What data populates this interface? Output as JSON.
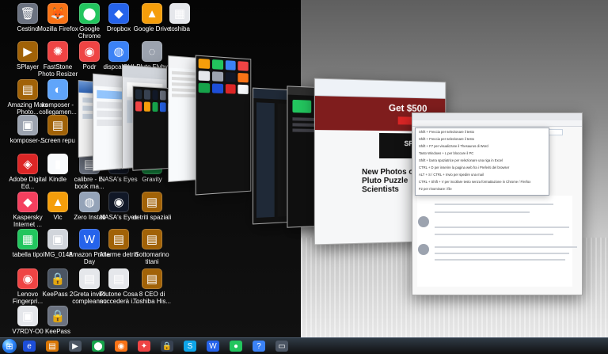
{
  "desktop": {
    "icons": [
      {
        "label": "Cestino",
        "glyph": "🗑",
        "color": "#6b7280"
      },
      {
        "label": "Mozilla Firefox",
        "glyph": "🦊",
        "color": "#f97316"
      },
      {
        "label": "Google Chrome",
        "glyph": "⬤",
        "color": "#22c55e"
      },
      {
        "label": "Dropbox",
        "glyph": "◆",
        "color": "#2563eb"
      },
      {
        "label": "Google Drive",
        "glyph": "▲",
        "color": "#f59e0b"
      },
      {
        "label": "toshiba",
        "glyph": "▦",
        "color": "#e5e7eb"
      },
      {
        "label": "SPlayer",
        "glyph": "▶",
        "color": "#a16207"
      },
      {
        "label": "FastStone Photo Resizer",
        "glyph": "✺",
        "color": "#ef4444"
      },
      {
        "label": "Podr",
        "glyph": "◉",
        "color": "#ef4444"
      },
      {
        "label": "dispcalGUI",
        "glyph": "◍",
        "color": "#3b82f6"
      },
      {
        "label": "Pluto Flyby",
        "glyph": "◌",
        "color": "#9ca3af"
      },
      {
        "label": "Amazing Mars Photo...",
        "glyph": "▤",
        "color": "#a16207"
      },
      {
        "label": "komposer - collegamen...",
        "glyph": "◐",
        "color": "#60a5fa"
      },
      {
        "label": "komposer-...",
        "glyph": "▣",
        "color": "#9ca3af"
      },
      {
        "label": "Screen repu",
        "glyph": "▤",
        "color": "#a16207"
      },
      {
        "label": "Adobe Digital Ed...",
        "glyph": "◈",
        "color": "#dc2626"
      },
      {
        "label": "Kindle",
        "glyph": "▮",
        "color": "#f8fafc"
      },
      {
        "label": "calibre - E-book ma...",
        "glyph": "▤",
        "color": "#6b7280"
      },
      {
        "label": "NASA's Eyes",
        "glyph": "◉",
        "color": "#111827"
      },
      {
        "label": "Gravity",
        "glyph": "✶",
        "color": "#16a34a"
      },
      {
        "label": "Kaspersky Internet ...",
        "glyph": "◆",
        "color": "#f43f5e"
      },
      {
        "label": "Vlc",
        "glyph": "▲",
        "color": "#f59e0b"
      },
      {
        "label": "Zero Install",
        "glyph": "◍",
        "color": "#94a3b8"
      },
      {
        "label": "NASA's Eyes",
        "glyph": "◉",
        "color": "#111827"
      },
      {
        "label": "detriti spaziali",
        "glyph": "▤",
        "color": "#a16207"
      },
      {
        "label": "tabella tipo",
        "glyph": "▦",
        "color": "#22c55e"
      },
      {
        "label": "IMG_0148",
        "glyph": "▣",
        "color": "#d1d5db"
      },
      {
        "label": "Amazon Prime Day",
        "glyph": "W",
        "color": "#2563eb"
      },
      {
        "label": "Allarme detriti",
        "glyph": "▤",
        "color": "#a16207"
      },
      {
        "label": "Sottomarino titani",
        "glyph": "▤",
        "color": "#a16207"
      },
      {
        "label": "Lenovo Fingerpri...",
        "glyph": "◉",
        "color": "#ef4444"
      },
      {
        "label": "KeePass 2",
        "glyph": "🔒",
        "color": "#4b5563"
      },
      {
        "label": "Greta invito compleanno",
        "glyph": "▤",
        "color": "#e5e7eb"
      },
      {
        "label": "Plutone Cosa succederà i...",
        "glyph": "▤",
        "color": "#e5e7eb"
      },
      {
        "label": "8 CEO di Toshiba His...",
        "glyph": "▤",
        "color": "#a16207"
      },
      {
        "label": "V7RDY-O0",
        "glyph": "▣",
        "color": "#e5e7eb"
      },
      {
        "label": "KeePass",
        "glyph": "🔒",
        "color": "#6b7280"
      }
    ]
  },
  "browser_front": {
    "menu_items": [
      "Shift + Freccia per selezionare il testo",
      "Shift + Freccia per selezionare il testo",
      "Shift + F7 per visualizzare il Thesaurus di Word",
      "Tasto Windows + L per bloccare il PC",
      "Shift + barra spaziatrice per selezionare una riga in Excel",
      "CTRL + D per inserire la pagina web fra i Preferiti del browser",
      "ALT + S / CTRL + Invio per spedire una mail",
      "CTRL + Shift + V per incollare testo senza formattazione in Chrome / Firefox",
      "F2 per rinominare i file"
    ],
    "search_placeholder": "Segnala",
    "headline": "New Photos of Pluto Puzzle Scientists",
    "promo": "Get $500",
    "space_label": "SPACE"
  },
  "taskbar": {
    "items": [
      {
        "name": "ie",
        "glyph": "e",
        "color": "#1d4ed8"
      },
      {
        "name": "explorer",
        "glyph": "▤",
        "color": "#d97706"
      },
      {
        "name": "media",
        "glyph": "▶",
        "color": "#4b5563"
      },
      {
        "name": "chrome",
        "glyph": "⬤",
        "color": "#16a34a"
      },
      {
        "name": "firefox",
        "glyph": "◉",
        "color": "#f97316"
      },
      {
        "name": "maps",
        "glyph": "✦",
        "color": "#ef4444"
      },
      {
        "name": "keepass",
        "glyph": "🔒",
        "color": "#374151"
      },
      {
        "name": "skype",
        "glyph": "S",
        "color": "#0ea5e9"
      },
      {
        "name": "word",
        "glyph": "W",
        "color": "#2563eb"
      },
      {
        "name": "spotify",
        "glyph": "●",
        "color": "#22c55e"
      },
      {
        "name": "help",
        "glyph": "?",
        "color": "#3b82f6"
      },
      {
        "name": "display",
        "glyph": "▭",
        "color": "#4b5563"
      }
    ]
  }
}
